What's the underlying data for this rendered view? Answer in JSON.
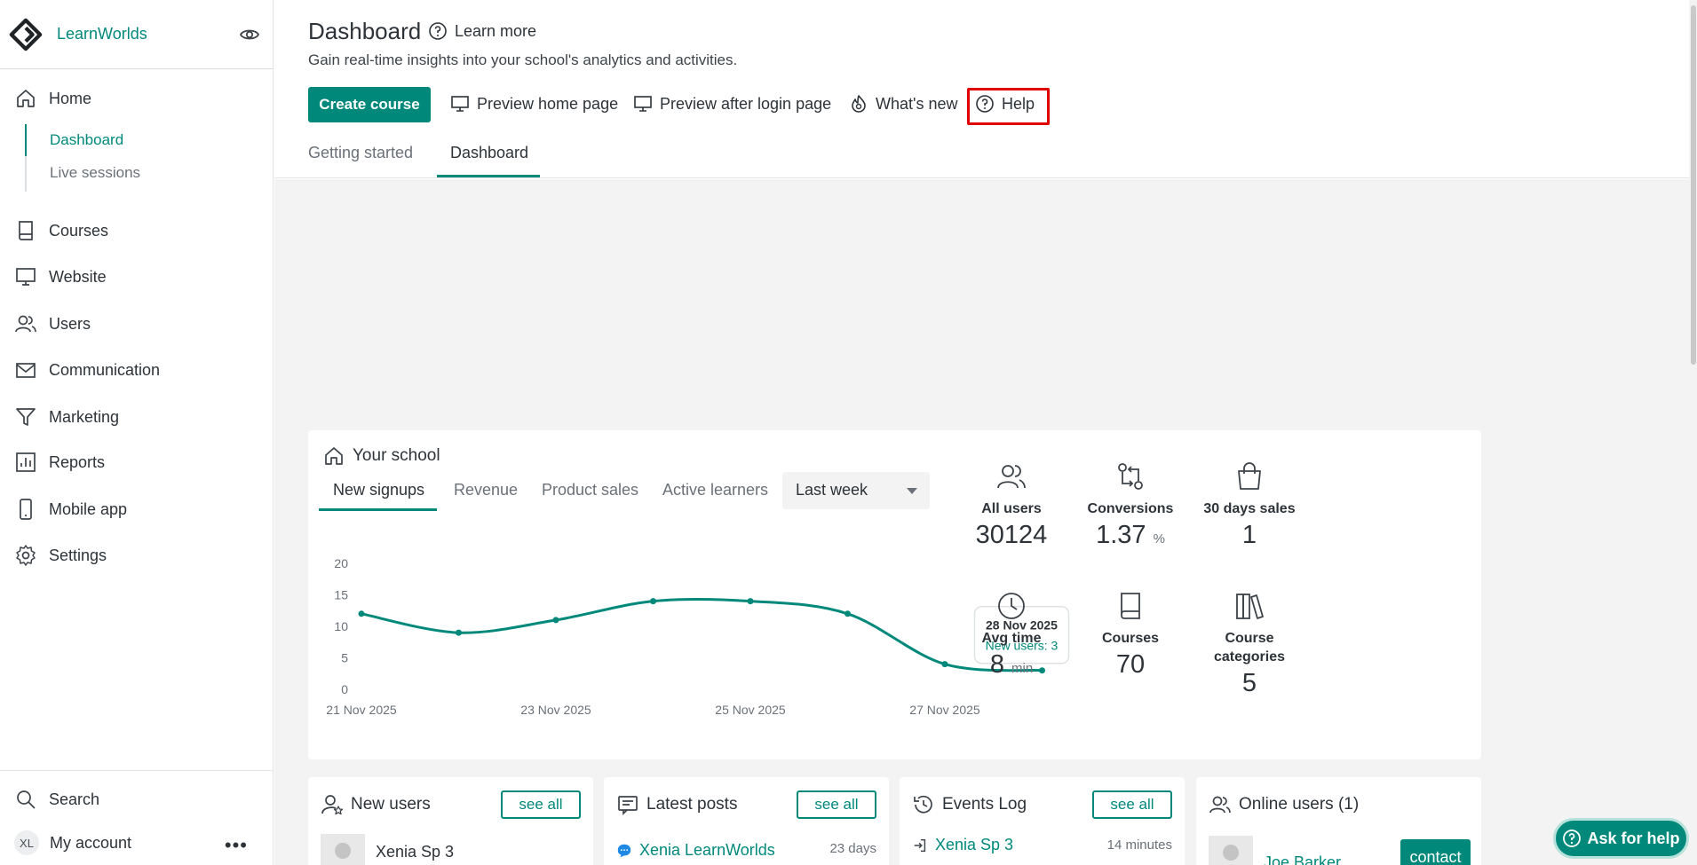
{
  "brand": {
    "name": "LearnWorlds"
  },
  "sidebar": {
    "items": [
      {
        "label": "Home",
        "icon": "home-icon"
      },
      {
        "label": "Courses",
        "icon": "book-icon"
      },
      {
        "label": "Website",
        "icon": "monitor-icon"
      },
      {
        "label": "Users",
        "icon": "users-icon"
      },
      {
        "label": "Communication",
        "icon": "mail-icon"
      },
      {
        "label": "Marketing",
        "icon": "filter-icon"
      },
      {
        "label": "Reports",
        "icon": "reports-icon"
      },
      {
        "label": "Mobile app",
        "icon": "mobile-icon"
      },
      {
        "label": "Settings",
        "icon": "gear-icon"
      }
    ],
    "sub_items": [
      {
        "label": "Dashboard"
      },
      {
        "label": "Live sessions"
      }
    ],
    "search_label": "Search",
    "account": {
      "initials": "XL",
      "label": "My account",
      "more": "•••"
    }
  },
  "header": {
    "title": "Dashboard",
    "learn_more": "Learn more",
    "subtitle": "Gain real-time insights into your school's analytics and activities.",
    "create_course": "Create course",
    "links": {
      "preview_home": "Preview home page",
      "preview_after_login": "Preview after login page",
      "whats_new": "What's new",
      "help": "Help"
    },
    "tabs": [
      {
        "label": "Getting started"
      },
      {
        "label": "Dashboard"
      }
    ]
  },
  "school": {
    "title": "Your school",
    "tabs": [
      {
        "label": "New signups"
      },
      {
        "label": "Revenue"
      },
      {
        "label": "Product sales"
      },
      {
        "label": "Active learners"
      }
    ],
    "range": "Last week",
    "stats": [
      {
        "label": "All users",
        "value": "30124",
        "unit": ""
      },
      {
        "label": "Conversions",
        "value": "1.37",
        "unit": "%"
      },
      {
        "label": "30 days sales",
        "value": "1",
        "unit": ""
      },
      {
        "label": "Avg time",
        "value": "8",
        "unit": "min"
      },
      {
        "label": "Courses",
        "value": "70",
        "unit": ""
      },
      {
        "label": "Course categories",
        "value": "5",
        "unit": ""
      }
    ]
  },
  "chart_data": {
    "type": "line",
    "x": [
      "21 Nov 2025",
      "22 Nov 2025",
      "23 Nov 2025",
      "24 Nov 2025",
      "25 Nov 2025",
      "26 Nov 2025",
      "27 Nov 2025",
      "28 Nov 2025"
    ],
    "x_tick_labels": [
      "21 Nov 2025",
      "23 Nov 2025",
      "25 Nov 2025",
      "27 Nov 2025"
    ],
    "series": [
      {
        "values": [
          12,
          9,
          11,
          14,
          14,
          12,
          4,
          3
        ]
      }
    ],
    "y_ticks": [
      0,
      5,
      10,
      15,
      20
    ],
    "ylim": [
      0,
      20
    ],
    "tooltip": {
      "date": "28 Nov 2025",
      "text": "New users: 3"
    },
    "color": "#00897b"
  },
  "widgets": {
    "new_users": {
      "title": "New users",
      "see_all": "see all",
      "row_name": "Xenia Sp 3"
    },
    "latest_posts": {
      "title": "Latest posts",
      "see_all": "see all",
      "row_name": "Xenia LearnWorlds",
      "time": "23 days"
    },
    "events_log": {
      "title": "Events Log",
      "see_all": "see all",
      "row_name": "Xenia Sp 3",
      "time": "14 minutes"
    },
    "online_users": {
      "title": "Online users (1)",
      "row_name": "Joe Barker",
      "contact": "contact"
    }
  },
  "ask_help": "Ask for help",
  "colors": {
    "accent": "#00897b",
    "highlight": "#e00000"
  }
}
